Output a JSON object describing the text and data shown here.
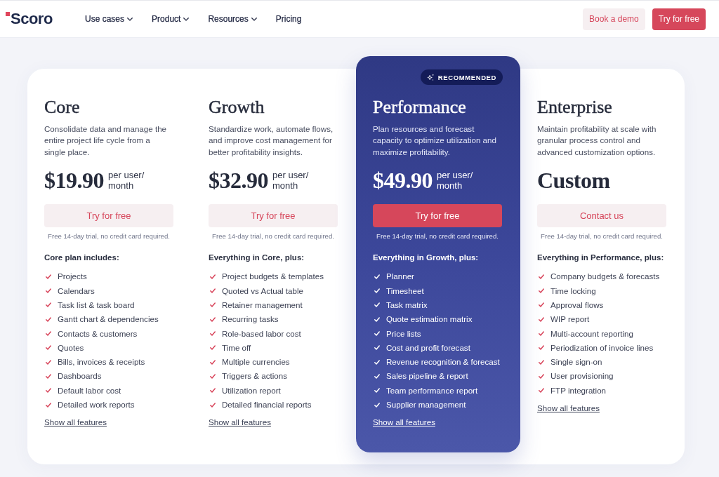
{
  "header": {
    "logo": "Scoro",
    "nav": [
      {
        "label": "Use cases",
        "has_menu": true
      },
      {
        "label": "Product",
        "has_menu": true
      },
      {
        "label": "Resources",
        "has_menu": true
      },
      {
        "label": "Pricing",
        "has_menu": false
      }
    ],
    "buttons": [
      {
        "label": "Book a demo",
        "kind": "secondary"
      },
      {
        "label": "Try for free",
        "kind": "primary"
      }
    ]
  },
  "plans": [
    {
      "name": "Core",
      "highlighted": false,
      "description": "Consolidate data and manage the entire project life cycle from a single place.",
      "price": "$19.90",
      "price_unit": "per user/ month",
      "cta": {
        "label": "Try for free",
        "kind": "secondary"
      },
      "note": "Free 14-day trial, no credit card required.",
      "features_heading": "Core plan includes:",
      "features": [
        "Projects",
        "Calendars",
        "Task list & task board",
        "Gantt chart & dependencies",
        "Contacts & customers",
        "Quotes",
        "Bills, invoices & receipts",
        "Dashboards",
        "Default labor cost",
        "Detailed work reports"
      ],
      "more_link": "Show all features"
    },
    {
      "name": "Growth",
      "highlighted": false,
      "description": "Standardize work, automate flows, and improve cost management for better profitability insights.",
      "price": "$32.90",
      "price_unit": "per user/ month",
      "cta": {
        "label": "Try for free",
        "kind": "secondary"
      },
      "note": "Free 14-day trial, no credit card required.",
      "features_heading": "Everything in Core, plus:",
      "features": [
        "Project budgets & templates",
        "Quoted vs Actual table",
        "Retainer management",
        "Recurring tasks",
        "Role-based labor cost",
        "Time off",
        "Multiple currencies",
        "Triggers & actions",
        "Utilization report",
        "Detailed financial reports"
      ],
      "more_link": "Show all features"
    },
    {
      "name": "Performance",
      "highlighted": true,
      "badge": "RECOMMENDED",
      "description": "Plan resources and forecast capacity to optimize utilization and maximize profitability.",
      "price": "$49.90",
      "price_unit": "per user/ month",
      "cta": {
        "label": "Try for free",
        "kind": "primary"
      },
      "note": "Free 14-day trial, no credit card required.",
      "features_heading": "Everything in Growth, plus:",
      "features": [
        "Planner",
        "Timesheet",
        "Task matrix",
        "Quote estimation matrix",
        "Price lists",
        "Cost and profit forecast",
        "Revenue recognition & forecast",
        "Sales pipeline & report",
        "Team performance report",
        "Supplier management"
      ],
      "more_link": "Show all features"
    },
    {
      "name": "Enterprise",
      "highlighted": false,
      "description": "Maintain profitability at scale with granular process control and advanced customization options.",
      "price": "Custom",
      "cta": {
        "label": "Contact us",
        "kind": "secondary"
      },
      "note": "Free 14-day trial, no credit card required.",
      "features_heading": "Everything in Performance, plus:",
      "features": [
        "Company budgets & forecasts",
        "Time locking",
        "Approval flows",
        "WIP report",
        "Multi-account reporting",
        "Periodization of invoice lines",
        "Single sign-on",
        "User provisioning",
        "FTP integration"
      ],
      "more_link": "Show all features"
    }
  ]
}
